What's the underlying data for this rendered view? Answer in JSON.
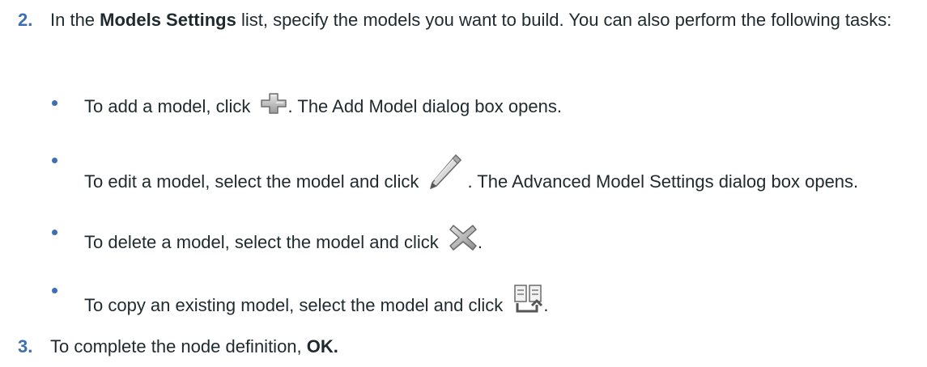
{
  "steps": [
    {
      "number": "2.",
      "text_before": "In the ",
      "bold": "Models Settings",
      "text_after": " list, specify the models you want to build. You can also perform the following tasks:"
    },
    {
      "number": "3.",
      "text_before": "To complete the node definition, ",
      "bold": "OK."
    }
  ],
  "bullets": [
    {
      "before": "To add a model, click ",
      "icon": "add-icon",
      "after": ". The Add Model dialog box opens."
    },
    {
      "before": "To edit a model, select the model and click ",
      "icon": "pencil-icon",
      "after": ". The Advanced Model Settings dialog box opens."
    },
    {
      "before": "To delete a model, select the model and click ",
      "icon": "delete-icon",
      "after": "."
    },
    {
      "before": "To copy an existing model, select the model and click ",
      "icon": "copy-icon",
      "after": "."
    }
  ],
  "colors": {
    "step_number": "#3f6fb3",
    "bullet": "#3f6fb3",
    "text": "#1f2a2e"
  }
}
